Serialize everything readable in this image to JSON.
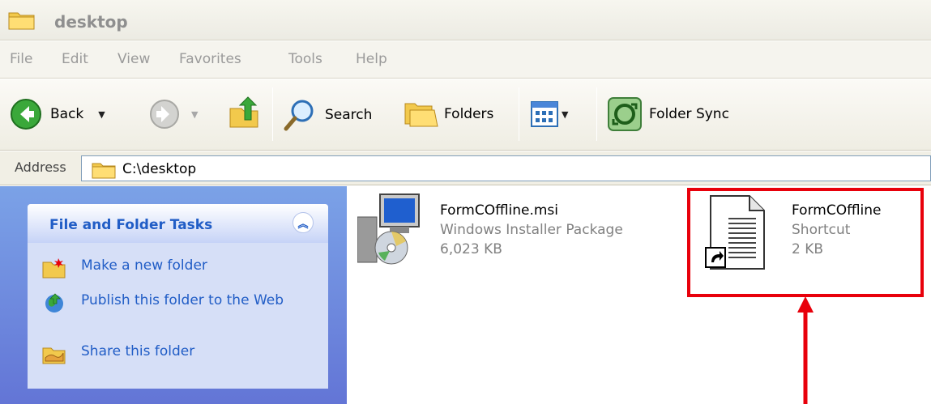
{
  "window": {
    "title": "desktop"
  },
  "menu": [
    "File",
    "Edit",
    "View",
    "Favorites",
    "Tools",
    "Help"
  ],
  "toolbar": {
    "back_label": "Back",
    "search_label": "Search",
    "folders_label": "Folders",
    "folder_sync_label": "Folder Sync"
  },
  "address": {
    "label": "Address",
    "value": "C:\\desktop"
  },
  "tasks": {
    "title": "File and Folder Tasks",
    "items": [
      {
        "label": "Make a new folder",
        "icon": "new-folder-icon"
      },
      {
        "label": "Publish this folder to the Web",
        "icon": "publish-web-icon"
      },
      {
        "label": "Share this folder",
        "icon": "share-folder-icon"
      }
    ]
  },
  "files": [
    {
      "name": "FormCOffline.msi",
      "type": "Windows Installer Package",
      "size": "6,023 KB",
      "icon": "installer-icon"
    },
    {
      "name": "FormCOffline",
      "type": "Shortcut",
      "size": "2 KB",
      "icon": "shortcut-file-icon"
    }
  ],
  "colors": {
    "highlight": "#e8000b",
    "task_link": "#215dc6",
    "pane_bg": "#6f8ede"
  }
}
